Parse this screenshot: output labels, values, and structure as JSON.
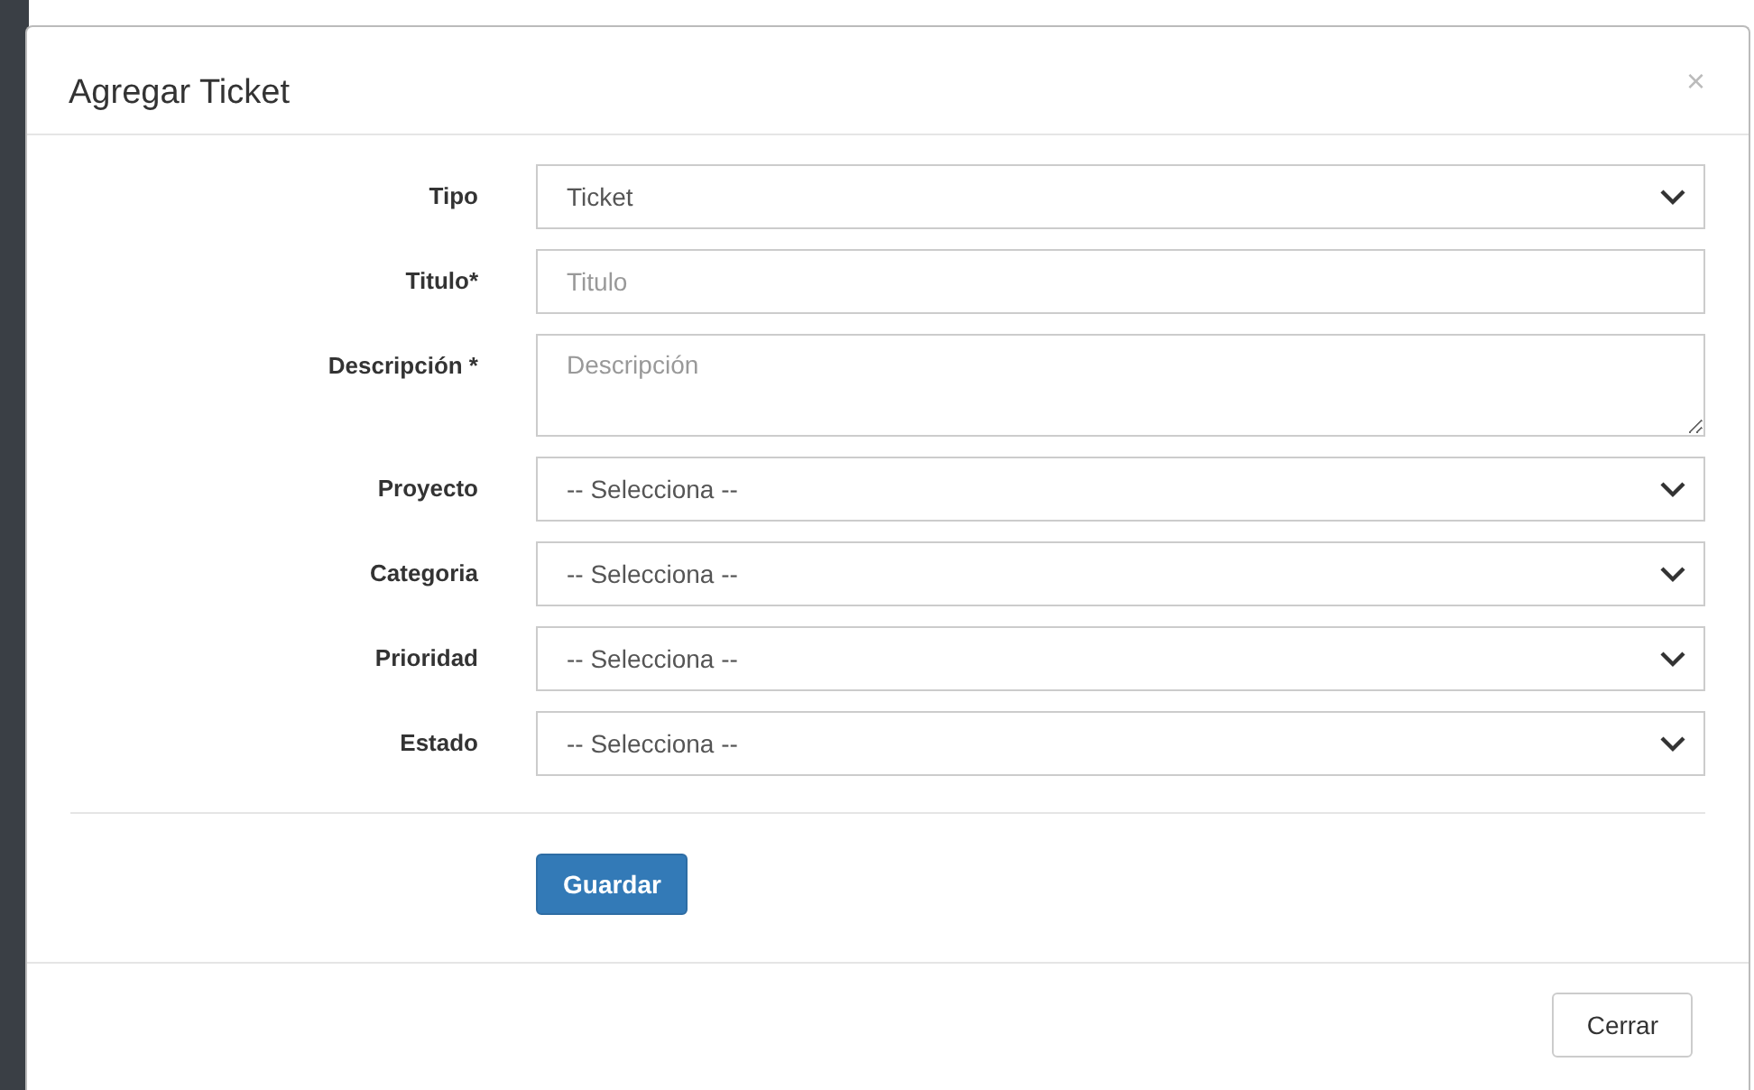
{
  "modal": {
    "title": "Agregar Ticket",
    "close": "×"
  },
  "fields": [
    {
      "label": "Tipo",
      "kind": "select",
      "value": "Ticket"
    },
    {
      "label": "Titulo*",
      "kind": "input",
      "placeholder": "Titulo"
    },
    {
      "label": "Descripción *",
      "kind": "textarea",
      "placeholder": "Descripción"
    },
    {
      "label": "Proyecto",
      "kind": "select",
      "value": "-- Selecciona --"
    },
    {
      "label": "Categoria",
      "kind": "select",
      "value": "-- Selecciona --"
    },
    {
      "label": "Prioridad",
      "kind": "select",
      "value": "-- Selecciona --"
    },
    {
      "label": "Estado",
      "kind": "select",
      "value": "-- Selecciona --"
    }
  ],
  "save_button": "Guardar",
  "footer_button": "Cerrar"
}
